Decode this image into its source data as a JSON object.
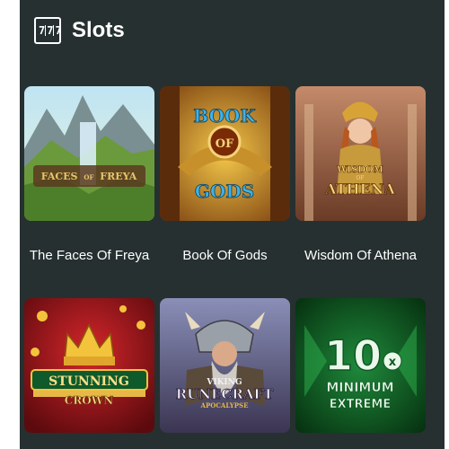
{
  "header": {
    "icon": "slot-machine-icon",
    "icon_glyphs": [
      "7",
      "7",
      "7"
    ],
    "title": "Slots"
  },
  "games": [
    {
      "name": "The Faces Of Freya",
      "logo_line1": "FACES",
      "logo_mid": "OF",
      "logo_line2": "FREYA"
    },
    {
      "name": "Book Of Gods",
      "logo_line1": "BOOK",
      "logo_mid": "OF",
      "logo_line2": "GODS"
    },
    {
      "name": "Wisdom Of Athena",
      "logo_line1": "WISDOM",
      "logo_mid": "OF",
      "logo_line2": "ATHENA"
    },
    {
      "name": "",
      "logo_line1": "STUNNING",
      "logo_line2": "CROWN"
    },
    {
      "name": "",
      "logo_line1": "VIKING",
      "logo_line2": "RUNECRAFT",
      "logo_line3": "APOCALYPSE"
    },
    {
      "name": "",
      "logo_line1": "10",
      "logo_sub": "x",
      "logo_line2": "MINIMUM",
      "logo_line3": "EXTREME"
    }
  ],
  "colors": {
    "background": "#263030",
    "text": "#ffffff"
  }
}
